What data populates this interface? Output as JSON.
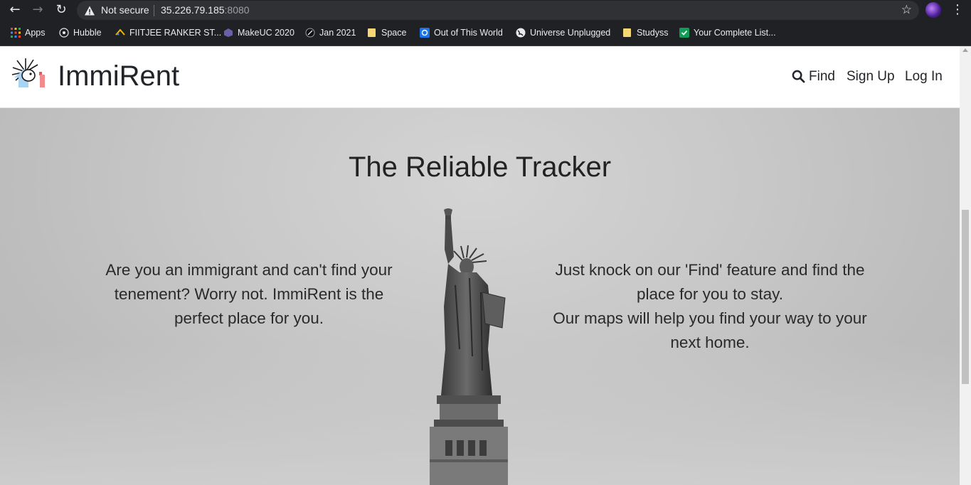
{
  "browser": {
    "security_label": "Not secure",
    "url_host": "35.226.79.185",
    "url_port": ":8080",
    "icons": [
      "back-icon",
      "forward-icon",
      "reload-icon",
      "warning-icon",
      "star-icon",
      "menu-icon"
    ]
  },
  "bookmarks": [
    {
      "label": "Apps",
      "icon": "apps-grid-icon"
    },
    {
      "label": "Hubble",
      "icon": "hubble-icon"
    },
    {
      "label": "FIITJEE RANKER ST...",
      "icon": "fiitjee-icon"
    },
    {
      "label": "MakeUC 2020",
      "icon": "makeuc-icon"
    },
    {
      "label": "Jan 2021",
      "icon": "jan-icon"
    },
    {
      "label": "Space",
      "icon": "folder-icon"
    },
    {
      "label": "Out of This World",
      "icon": "otw-icon"
    },
    {
      "label": "Universe Unplugged",
      "icon": "globe-icon"
    },
    {
      "label": "Studyss",
      "icon": "folder-icon"
    },
    {
      "label": "Your Complete List...",
      "icon": "check-icon"
    }
  ],
  "site": {
    "brand": "ImmiRent",
    "nav": {
      "find": "Find",
      "signup": "Sign Up",
      "login": "Log In"
    },
    "hero": {
      "title": "The Reliable Tracker",
      "left_text": "Are you an immigrant and can't find your tenement? Worry not. ImmiRent is the perfect place for you.",
      "right_line1": "Just knock on our 'Find' feature and find the place for you to stay.",
      "right_line2": "Our maps will help you find your way to your next home."
    }
  },
  "colors": {
    "chrome_bg": "#202124",
    "omnibox_bg": "#303134",
    "text_dark": "#212529"
  }
}
